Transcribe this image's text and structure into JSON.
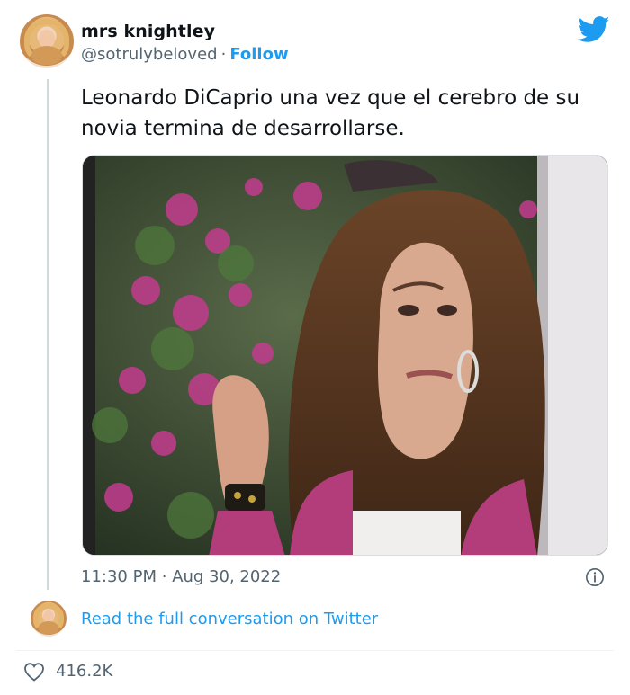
{
  "user": {
    "display_name": "mrs knightley",
    "handle": "@sotrulybeloved",
    "separator": "·",
    "follow_label": "Follow"
  },
  "tweet": {
    "text": "Leonardo DiCaprio una vez que el cerebro de su novia termina de desarrollarse.",
    "time": "11:30 PM",
    "date_separator": "·",
    "date": "Aug 30, 2022"
  },
  "footer": {
    "read_conversation_label": "Read the full conversation on Twitter",
    "like_count": "416.2K"
  },
  "icons": {
    "brand": "twitter-bird-icon",
    "info": "info-icon",
    "like": "heart-icon"
  },
  "colors": {
    "accent": "#1d9bf0",
    "text_primary": "#0f1419",
    "text_secondary": "#536471"
  }
}
